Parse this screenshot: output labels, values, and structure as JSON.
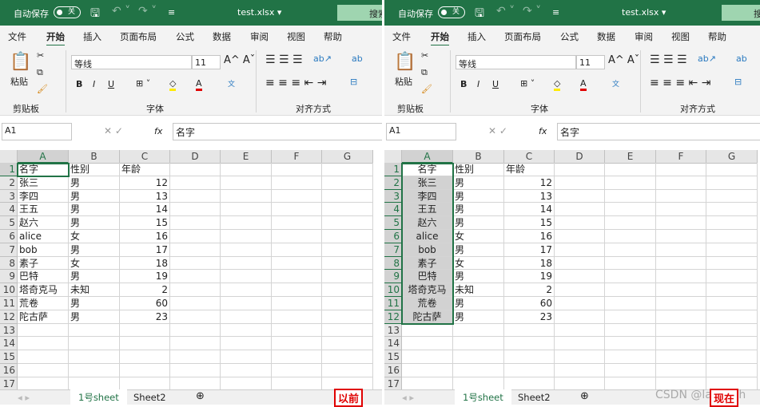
{
  "title": {
    "autosave": "自动保存",
    "toggle": "关",
    "filename": "test.xlsx ▾",
    "search": "搜索"
  },
  "tabs": [
    "文件",
    "开始",
    "插入",
    "页面布局",
    "公式",
    "数据",
    "审阅",
    "视图",
    "帮助"
  ],
  "ribbon": {
    "paste": "粘贴",
    "font_name": "等线",
    "font_size": "11",
    "bold": "B",
    "italic": "I",
    "underline": "U",
    "groups": [
      "剪贴板",
      "字体",
      "对齐方式"
    ]
  },
  "formula": {
    "name_box": "A1",
    "fx": "fx",
    "content": "名字"
  },
  "columns": [
    "A",
    "B",
    "C",
    "D",
    "E",
    "F",
    "G"
  ],
  "rows": [
    [
      "名字",
      "性别",
      "年龄"
    ],
    [
      "张三",
      "男",
      "12"
    ],
    [
      "李四",
      "男",
      "13"
    ],
    [
      "王五",
      "男",
      "14"
    ],
    [
      "赵六",
      "男",
      "15"
    ],
    [
      "alice",
      "女",
      "16"
    ],
    [
      "bob",
      "男",
      "17"
    ],
    [
      "素子",
      "女",
      "18"
    ],
    [
      "巴特",
      "男",
      "19"
    ],
    [
      "塔奇克马",
      "未知",
      "2"
    ],
    [
      "荒卷",
      "男",
      "60"
    ],
    [
      "陀古萨",
      "男",
      "23"
    ]
  ],
  "row_count": 17,
  "sheets": [
    "1号sheet",
    "Sheet2",
    "⊕"
  ],
  "labels": {
    "before": "以前",
    "after": "现在"
  },
  "watermark": "CSDN @lainwith",
  "colors": {
    "green": "#217346",
    "red": "#e00000"
  }
}
